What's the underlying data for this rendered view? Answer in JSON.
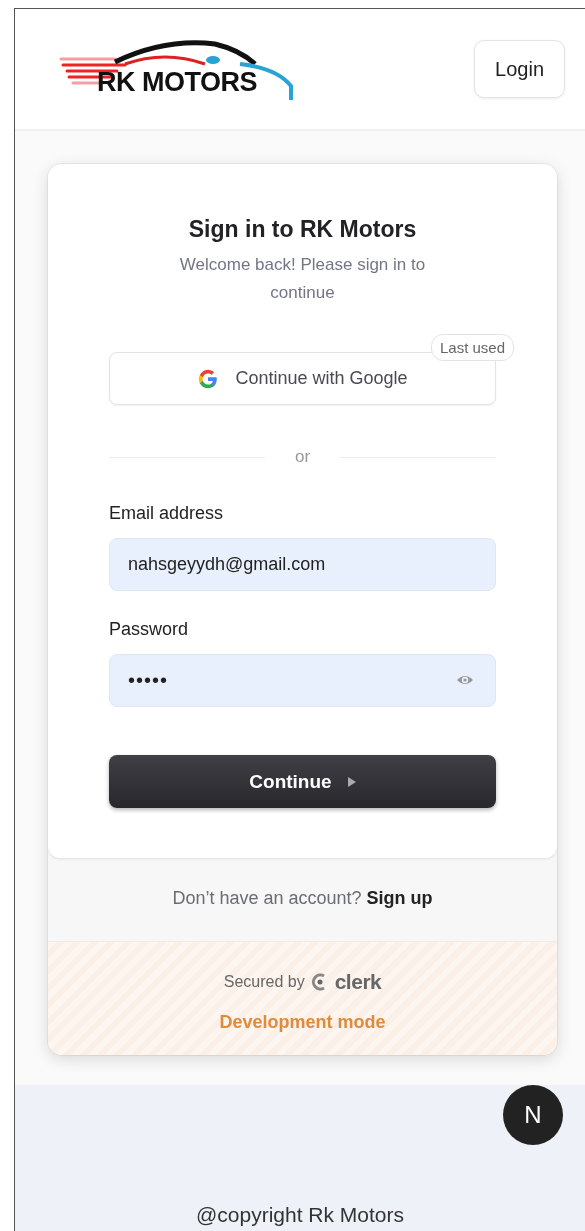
{
  "header": {
    "logo_text": "RK MOTORS",
    "login_button": "Login"
  },
  "sign_in": {
    "title": "Sign in to RK Motors",
    "subtitle": "Welcome back! Please sign in to continue",
    "google_button": "Continue with Google",
    "last_used_badge": "Last used",
    "divider": "or",
    "fields": [
      {
        "label": "Email address",
        "value": "nahsgeyydh@gmail.com",
        "kind": "text"
      },
      {
        "label": "Password",
        "value": "•••••",
        "kind": "password"
      }
    ],
    "continue_button": "Continue"
  },
  "footer": {
    "prompt": "Don’t have an account?",
    "link": "Sign up",
    "secured_by": "Secured by",
    "brand": "clerk",
    "dev_mode": "Development mode"
  },
  "dev_badge": "N",
  "copyright": "@copyright Rk Motors"
}
